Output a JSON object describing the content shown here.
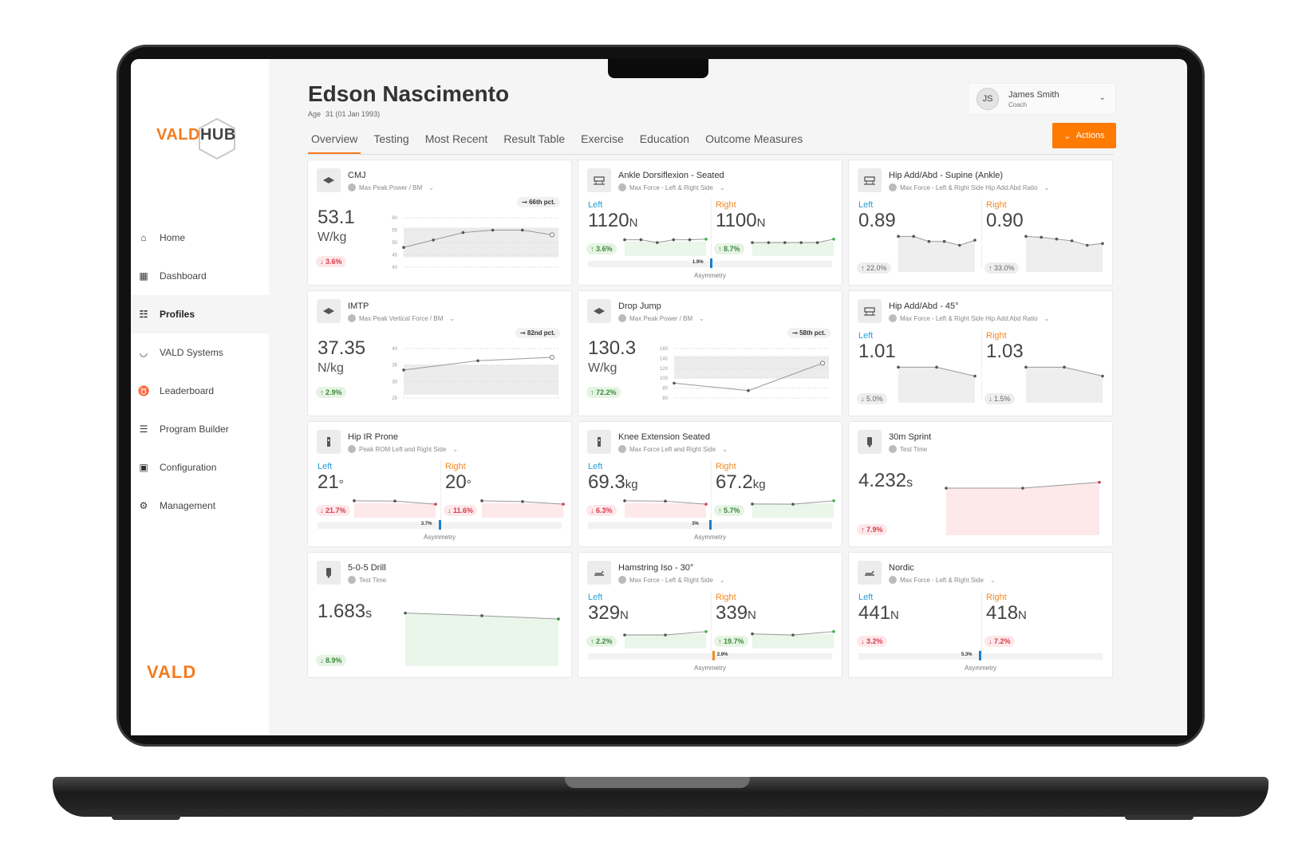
{
  "sidebar": {
    "logo_hub": {
      "vald": "VALD",
      "hub": "HUB"
    },
    "items": [
      {
        "label": "Home",
        "icon": "home-icon",
        "glyph": "⌂",
        "active": false
      },
      {
        "label": "Dashboard",
        "icon": "dashboard-icon",
        "glyph": "▦",
        "active": false
      },
      {
        "label": "Profiles",
        "icon": "profiles-icon",
        "glyph": "☷",
        "active": true
      },
      {
        "label": "VALD Systems",
        "icon": "systems-icon",
        "glyph": "◡",
        "active": false
      },
      {
        "label": "Leaderboard",
        "icon": "medal-icon",
        "glyph": "♉",
        "active": false
      },
      {
        "label": "Program Builder",
        "icon": "list-icon",
        "glyph": "☰",
        "active": false
      },
      {
        "label": "Configuration",
        "icon": "folder-gear-icon",
        "glyph": "▣",
        "active": false
      },
      {
        "label": "Management",
        "icon": "management-icon",
        "glyph": "⚙",
        "active": false
      }
    ],
    "logo_bottom": "VALD"
  },
  "header": {
    "name": "Edson Nascimento",
    "age_label": "Age",
    "age_value": "31 (01 Jan 1993)",
    "tabs": [
      "Overview",
      "Testing",
      "Most Recent",
      "Result Table",
      "Exercise",
      "Education",
      "Outcome Measures"
    ],
    "active_tab": "Overview",
    "user": {
      "initials": "JS",
      "name": "James Smith",
      "role": "Coach"
    },
    "actions_label": "Actions"
  },
  "colors": {
    "accent": "#ff7a00",
    "left": "#2a9fd8",
    "right": "#f08a24",
    "up": "#3d8a3d",
    "down": "#d63c4a"
  },
  "cards": [
    {
      "id": "cmj",
      "type": "single-range",
      "title": "CMJ",
      "subtitle": "Max Peak Power / BM",
      "dropdown": true,
      "icon": "force-plate-icon",
      "value": "53.1",
      "unit": "W/kg",
      "delta": "↓ 3.6%",
      "delta_dir": "down",
      "percentile": "66th pct.",
      "yticks": [
        60,
        55,
        50,
        45,
        40
      ],
      "ylim": [
        40,
        60
      ],
      "band": [
        44,
        56
      ],
      "points": [
        48,
        51,
        54,
        55,
        55,
        53.1
      ]
    },
    {
      "id": "ankle-df",
      "type": "bilateral",
      "title": "Ankle Dorsiflexion - Seated",
      "subtitle": "Max Force - Left & Right Side",
      "dropdown": true,
      "icon": "dynamo-bench-icon",
      "left": {
        "label": "Left",
        "value": "1120",
        "unit": "N",
        "delta": "↑ 3.6%",
        "delta_dir": "up",
        "points": [
          5,
          5,
          4,
          5,
          5,
          5.2
        ]
      },
      "right": {
        "label": "Right",
        "value": "1100",
        "unit": "N",
        "delta": "↑ 8.7%",
        "delta_dir": "up",
        "points": [
          5,
          5,
          5,
          5,
          5,
          5.2
        ]
      },
      "asymmetry": {
        "value": "1.9%",
        "side": "left",
        "color": "#1a7fd0"
      },
      "asymmetry_label": "Asymmetry"
    },
    {
      "id": "hip-add-supine",
      "type": "bilateral-area",
      "title": "Hip Add/Abd - Supine (Ankle)",
      "subtitle": "Max Force - Left & Right Side Hip Add:Abd Ratio",
      "dropdown": true,
      "icon": "dynamo-bench-icon",
      "left": {
        "label": "Left",
        "value": "0.89",
        "unit": "",
        "delta": "↑ 22.0%",
        "delta_dir": "neutral",
        "points": [
          0.92,
          0.92,
          0.88,
          0.88,
          0.85,
          0.89
        ]
      },
      "right": {
        "label": "Right",
        "value": "0.90",
        "unit": "",
        "delta": "↑ 33.0%",
        "delta_dir": "neutral",
        "points": [
          0.98,
          0.97,
          0.95,
          0.93,
          0.88,
          0.9
        ]
      }
    },
    {
      "id": "imtp",
      "type": "single-range",
      "title": "IMTP",
      "subtitle": "Max Peak Vertical Force / BM",
      "dropdown": true,
      "icon": "force-plate-icon",
      "value": "37.35",
      "unit": "N/kg",
      "delta": "↑ 2.9%",
      "delta_dir": "up",
      "percentile": "82nd pct.",
      "yticks": [
        40,
        35,
        30,
        25
      ],
      "ylim": [
        25,
        40
      ],
      "band": [
        26,
        35
      ],
      "points": [
        33.5,
        36.3,
        37.35
      ]
    },
    {
      "id": "drop-jump",
      "type": "single-range",
      "title": "Drop Jump",
      "subtitle": "Max Peak Power / BM",
      "dropdown": true,
      "icon": "force-plate-icon",
      "value": "130.3",
      "unit": "W/kg",
      "delta": "↑ 72.2%",
      "delta_dir": "up",
      "percentile": "58th pct.",
      "yticks": [
        160,
        140,
        120,
        100,
        80,
        60
      ],
      "ylim": [
        60,
        160
      ],
      "band": [
        100,
        145
      ],
      "points": [
        90,
        75,
        130.3
      ]
    },
    {
      "id": "hip-add-45",
      "type": "bilateral-area",
      "title": "Hip Add/Abd - 45°",
      "subtitle": "Max Force - Left & Right Side Hip Add:Abd Ratio",
      "dropdown": true,
      "icon": "dynamo-bench-icon",
      "left": {
        "label": "Left",
        "value": "1.01",
        "unit": "",
        "delta": "↓ 5.0%",
        "delta_dir": "neutral",
        "points": [
          1.06,
          1.06,
          1.01
        ]
      },
      "right": {
        "label": "Right",
        "value": "1.03",
        "unit": "",
        "delta": "↓ 1.5%",
        "delta_dir": "neutral",
        "points": [
          1.045,
          1.045,
          1.03
        ]
      }
    },
    {
      "id": "hip-ir",
      "type": "bilateral",
      "title": "Hip IR Prone",
      "subtitle": "Peak ROM Left and Right Side",
      "dropdown": true,
      "icon": "dynamo-handheld-icon",
      "left": {
        "label": "Left",
        "value": "21",
        "unit": "°",
        "delta": "↓ 21.7%",
        "delta_dir": "down",
        "points": [
          27,
          26.5,
          21
        ]
      },
      "right": {
        "label": "Right",
        "value": "20",
        "unit": "°",
        "delta": "↓ 11.6%",
        "delta_dir": "down",
        "points": [
          22.6,
          22,
          20
        ]
      },
      "asymmetry": {
        "value": "3.7%",
        "side": "left",
        "color": "#1a7fd0"
      },
      "asymmetry_label": "Asymmetry"
    },
    {
      "id": "knee-ext",
      "type": "bilateral",
      "title": "Knee Extension Seated",
      "subtitle": "Max Force Left and Right Side",
      "dropdown": true,
      "icon": "dynamo-handheld-icon",
      "left": {
        "label": "Left",
        "value": "69.3",
        "unit": "kg",
        "delta": "↓ 6.3%",
        "delta_dir": "down",
        "points": [
          74,
          73.5,
          69.3
        ]
      },
      "right": {
        "label": "Right",
        "value": "67.2",
        "unit": "kg",
        "delta": "↑ 5.7%",
        "delta_dir": "up",
        "points": [
          63.6,
          63.4,
          67.2
        ]
      },
      "asymmetry": {
        "value": "3%",
        "side": "left",
        "color": "#1a7fd0"
      },
      "asymmetry_label": "Asymmetry"
    },
    {
      "id": "sprint30",
      "type": "single-area",
      "title": "30m Sprint",
      "subtitle": "Test Time",
      "dropdown": false,
      "icon": "timing-gate-icon",
      "value": "4.232",
      "unit": "s",
      "delta": "↑ 7.9%",
      "delta_dir": "down",
      "fill": "#fde8ea",
      "points": [
        4.22,
        4.22,
        4.232
      ]
    },
    {
      "id": "drill505",
      "type": "single-area",
      "title": "5-0-5 Drill",
      "subtitle": "Test Time",
      "dropdown": false,
      "icon": "timing-gate-icon",
      "value": "1.683",
      "unit": "s",
      "delta": "↓ 8.9%",
      "delta_dir": "up",
      "fill": "#e9f6e9",
      "points": [
        1.75,
        1.72,
        1.683
      ]
    },
    {
      "id": "hamstring-iso",
      "type": "bilateral",
      "title": "Hamstring Iso - 30°",
      "subtitle": "Max Force - Left & Right Side",
      "dropdown": true,
      "icon": "nordbord-icon",
      "left": {
        "label": "Left",
        "value": "329",
        "unit": "N",
        "delta": "↑ 2.2%",
        "delta_dir": "up",
        "points": [
          329,
          329,
          329.5
        ]
      },
      "right": {
        "label": "Right",
        "value": "339",
        "unit": "N",
        "delta": "↑ 19.7%",
        "delta_dir": "up",
        "points": [
          335,
          333,
          339
        ]
      },
      "asymmetry": {
        "value": "2.9%",
        "side": "right",
        "color": "#f08a24"
      },
      "asymmetry_label": "Asymmetry"
    },
    {
      "id": "nordic",
      "type": "bilateral",
      "title": "Nordic",
      "subtitle": "Max Force - Left & Right Side",
      "dropdown": true,
      "icon": "nordbord-icon",
      "left": {
        "label": "Left",
        "value": "441",
        "unit": "N",
        "delta": "↓ 3.2%",
        "delta_dir": "down",
        "points": []
      },
      "right": {
        "label": "Right",
        "value": "418",
        "unit": "N",
        "delta": "↓ 7.2%",
        "delta_dir": "down",
        "points": []
      },
      "asymmetry": {
        "value": "5.3%",
        "side": "left",
        "color": "#1a7fd0"
      },
      "asymmetry_label": "Asymmetry"
    }
  ]
}
